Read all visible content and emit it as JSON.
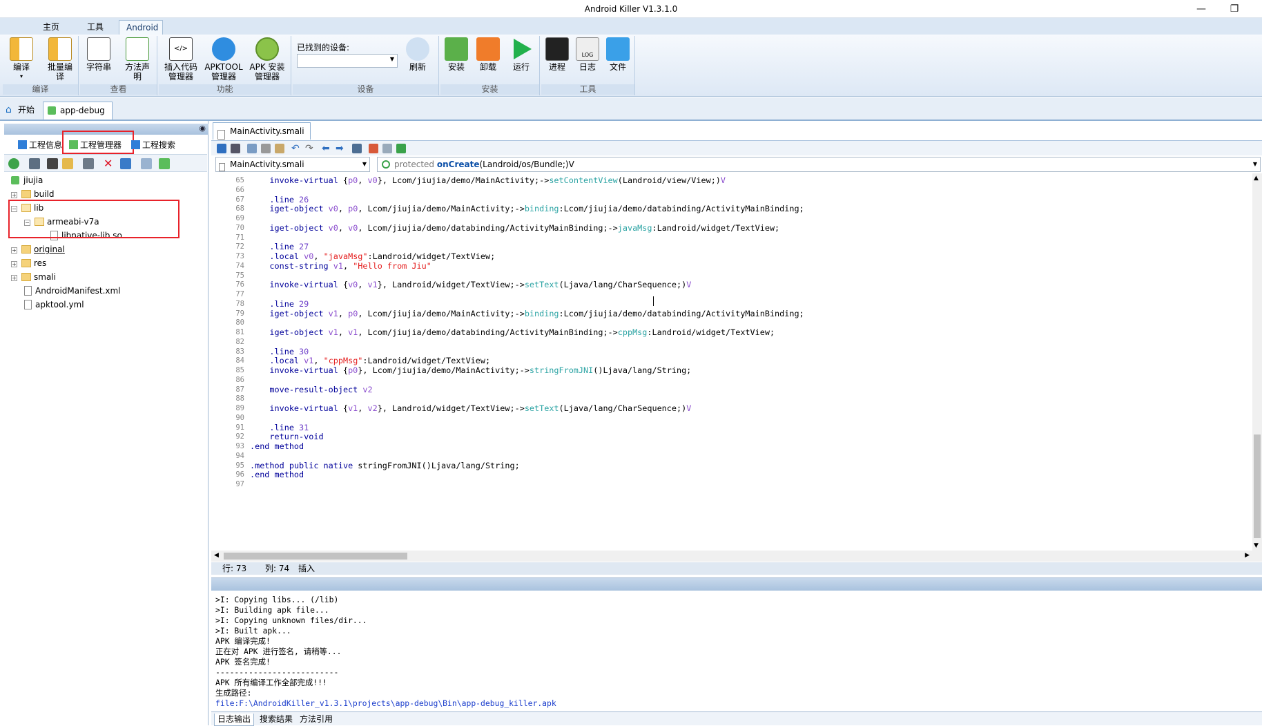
{
  "window": {
    "title": "Android Killer V1.3.1.0",
    "min_icon": "minimize-icon",
    "restore_icon": "restore-icon"
  },
  "ribbon_tabs": [
    "主页",
    "工具",
    "Android"
  ],
  "ribbon_groups": {
    "compile": {
      "label": "编译",
      "buttons": [
        "编译",
        "批量编\n译"
      ]
    },
    "view": {
      "label": "查看",
      "buttons": [
        "字符串",
        "方法声\n明"
      ]
    },
    "function": {
      "label": "功能",
      "buttons": [
        "插入代码\n管理器",
        "APKTOOL\n管理器",
        "APK 安装\n管理器"
      ]
    },
    "device": {
      "label": "设备",
      "found_label": "已找到的设备:",
      "refresh": "刷新"
    },
    "install": {
      "label": "安装",
      "buttons": [
        "安装",
        "卸载",
        "运行"
      ]
    },
    "tools": {
      "label": "工具",
      "buttons": [
        "进程",
        "日志",
        "文件"
      ]
    }
  },
  "doc_tabs": {
    "start": "开始",
    "project": "app-debug"
  },
  "left": {
    "tabs": [
      "工程信息",
      "工程管理器",
      "工程搜索"
    ],
    "tree": [
      {
        "label": "jiujia"
      },
      {
        "label": "build"
      },
      {
        "label": "lib"
      },
      {
        "label": "armeabi-v7a"
      },
      {
        "label": "libnative-lib.so"
      },
      {
        "label": "original"
      },
      {
        "label": "res"
      },
      {
        "label": "smali"
      },
      {
        "label": "AndroidManifest.xml"
      },
      {
        "label": "apktool.yml"
      }
    ]
  },
  "editor": {
    "tab": "MainActivity.smali",
    "class_combo": "MainActivity.smali",
    "method_modifier": "protected",
    "method_name": "onCreate",
    "method_sig": "(Landroid/os/Bundle;)V"
  },
  "code_lines": [
    {
      "n": "65",
      "t": "    invoke-virtual {p0, v0}, Lcom/jiujia/demo/MainActivity;->setContentView(Landroid/view/View;)V"
    },
    {
      "n": "66",
      "t": ""
    },
    {
      "n": "67",
      "t": "    .line 26"
    },
    {
      "n": "68",
      "t": "    iget-object v0, p0, Lcom/jiujia/demo/MainActivity;->binding:Lcom/jiujia/demo/databinding/ActivityMainBinding;"
    },
    {
      "n": "69",
      "t": ""
    },
    {
      "n": "70",
      "t": "    iget-object v0, v0, Lcom/jiujia/demo/databinding/ActivityMainBinding;->javaMsg:Landroid/widget/TextView;"
    },
    {
      "n": "71",
      "t": ""
    },
    {
      "n": "72",
      "t": "    .line 27"
    },
    {
      "n": "73",
      "t": "    .local v0, \"javaMsg\":Landroid/widget/TextView;"
    },
    {
      "n": "74",
      "t": "    const-string v1, \"Hello from Jiu\""
    },
    {
      "n": "75",
      "t": ""
    },
    {
      "n": "76",
      "t": "    invoke-virtual {v0, v1}, Landroid/widget/TextView;->setText(Ljava/lang/CharSequence;)V"
    },
    {
      "n": "77",
      "t": ""
    },
    {
      "n": "78",
      "t": "    .line 29"
    },
    {
      "n": "79",
      "t": "    iget-object v1, p0, Lcom/jiujia/demo/MainActivity;->binding:Lcom/jiujia/demo/databinding/ActivityMainBinding;"
    },
    {
      "n": "80",
      "t": ""
    },
    {
      "n": "81",
      "t": "    iget-object v1, v1, Lcom/jiujia/demo/databinding/ActivityMainBinding;->cppMsg:Landroid/widget/TextView;"
    },
    {
      "n": "82",
      "t": ""
    },
    {
      "n": "83",
      "t": "    .line 30"
    },
    {
      "n": "84",
      "t": "    .local v1, \"cppMsg\":Landroid/widget/TextView;"
    },
    {
      "n": "85",
      "t": "    invoke-virtual {p0}, Lcom/jiujia/demo/MainActivity;->stringFromJNI()Ljava/lang/String;"
    },
    {
      "n": "86",
      "t": ""
    },
    {
      "n": "87",
      "t": "    move-result-object v2"
    },
    {
      "n": "88",
      "t": ""
    },
    {
      "n": "89",
      "t": "    invoke-virtual {v1, v2}, Landroid/widget/TextView;->setText(Ljava/lang/CharSequence;)V"
    },
    {
      "n": "90",
      "t": ""
    },
    {
      "n": "91",
      "t": "    .line 31"
    },
    {
      "n": "92",
      "t": "    return-void"
    },
    {
      "n": "93",
      "t": ".end method"
    },
    {
      "n": "94",
      "t": ""
    },
    {
      "n": "95",
      "t": ".method public native stringFromJNI()Ljava/lang/String;"
    },
    {
      "n": "96",
      "t": ".end method"
    },
    {
      "n": "97",
      "t": ""
    }
  ],
  "status": {
    "row": "行: 73",
    "col": "列: 74",
    "mode": "插入"
  },
  "output_lines": [
    ">I: Copying libs... (/lib)",
    ">I: Building apk file...",
    ">I: Copying unknown files/dir...",
    ">I: Built apk...",
    "APK 编译完成!",
    "正在对 APK 进行签名, 请稍等...",
    "APK 签名完成!",
    "--------------------------",
    "APK 所有编译工作全部完成!!!",
    "生成路径:",
    "file:F:\\AndroidKiller_v1.3.1\\projects\\app-debug\\Bin\\app-debug_killer.apk"
  ],
  "output_tabs": [
    "日志输出",
    "搜索结果",
    "方法引用"
  ],
  "colors": {
    "accent": "#1a6fc4",
    "highlight_box": "#e8222a",
    "ribbon_bg": "#dde8f5"
  }
}
